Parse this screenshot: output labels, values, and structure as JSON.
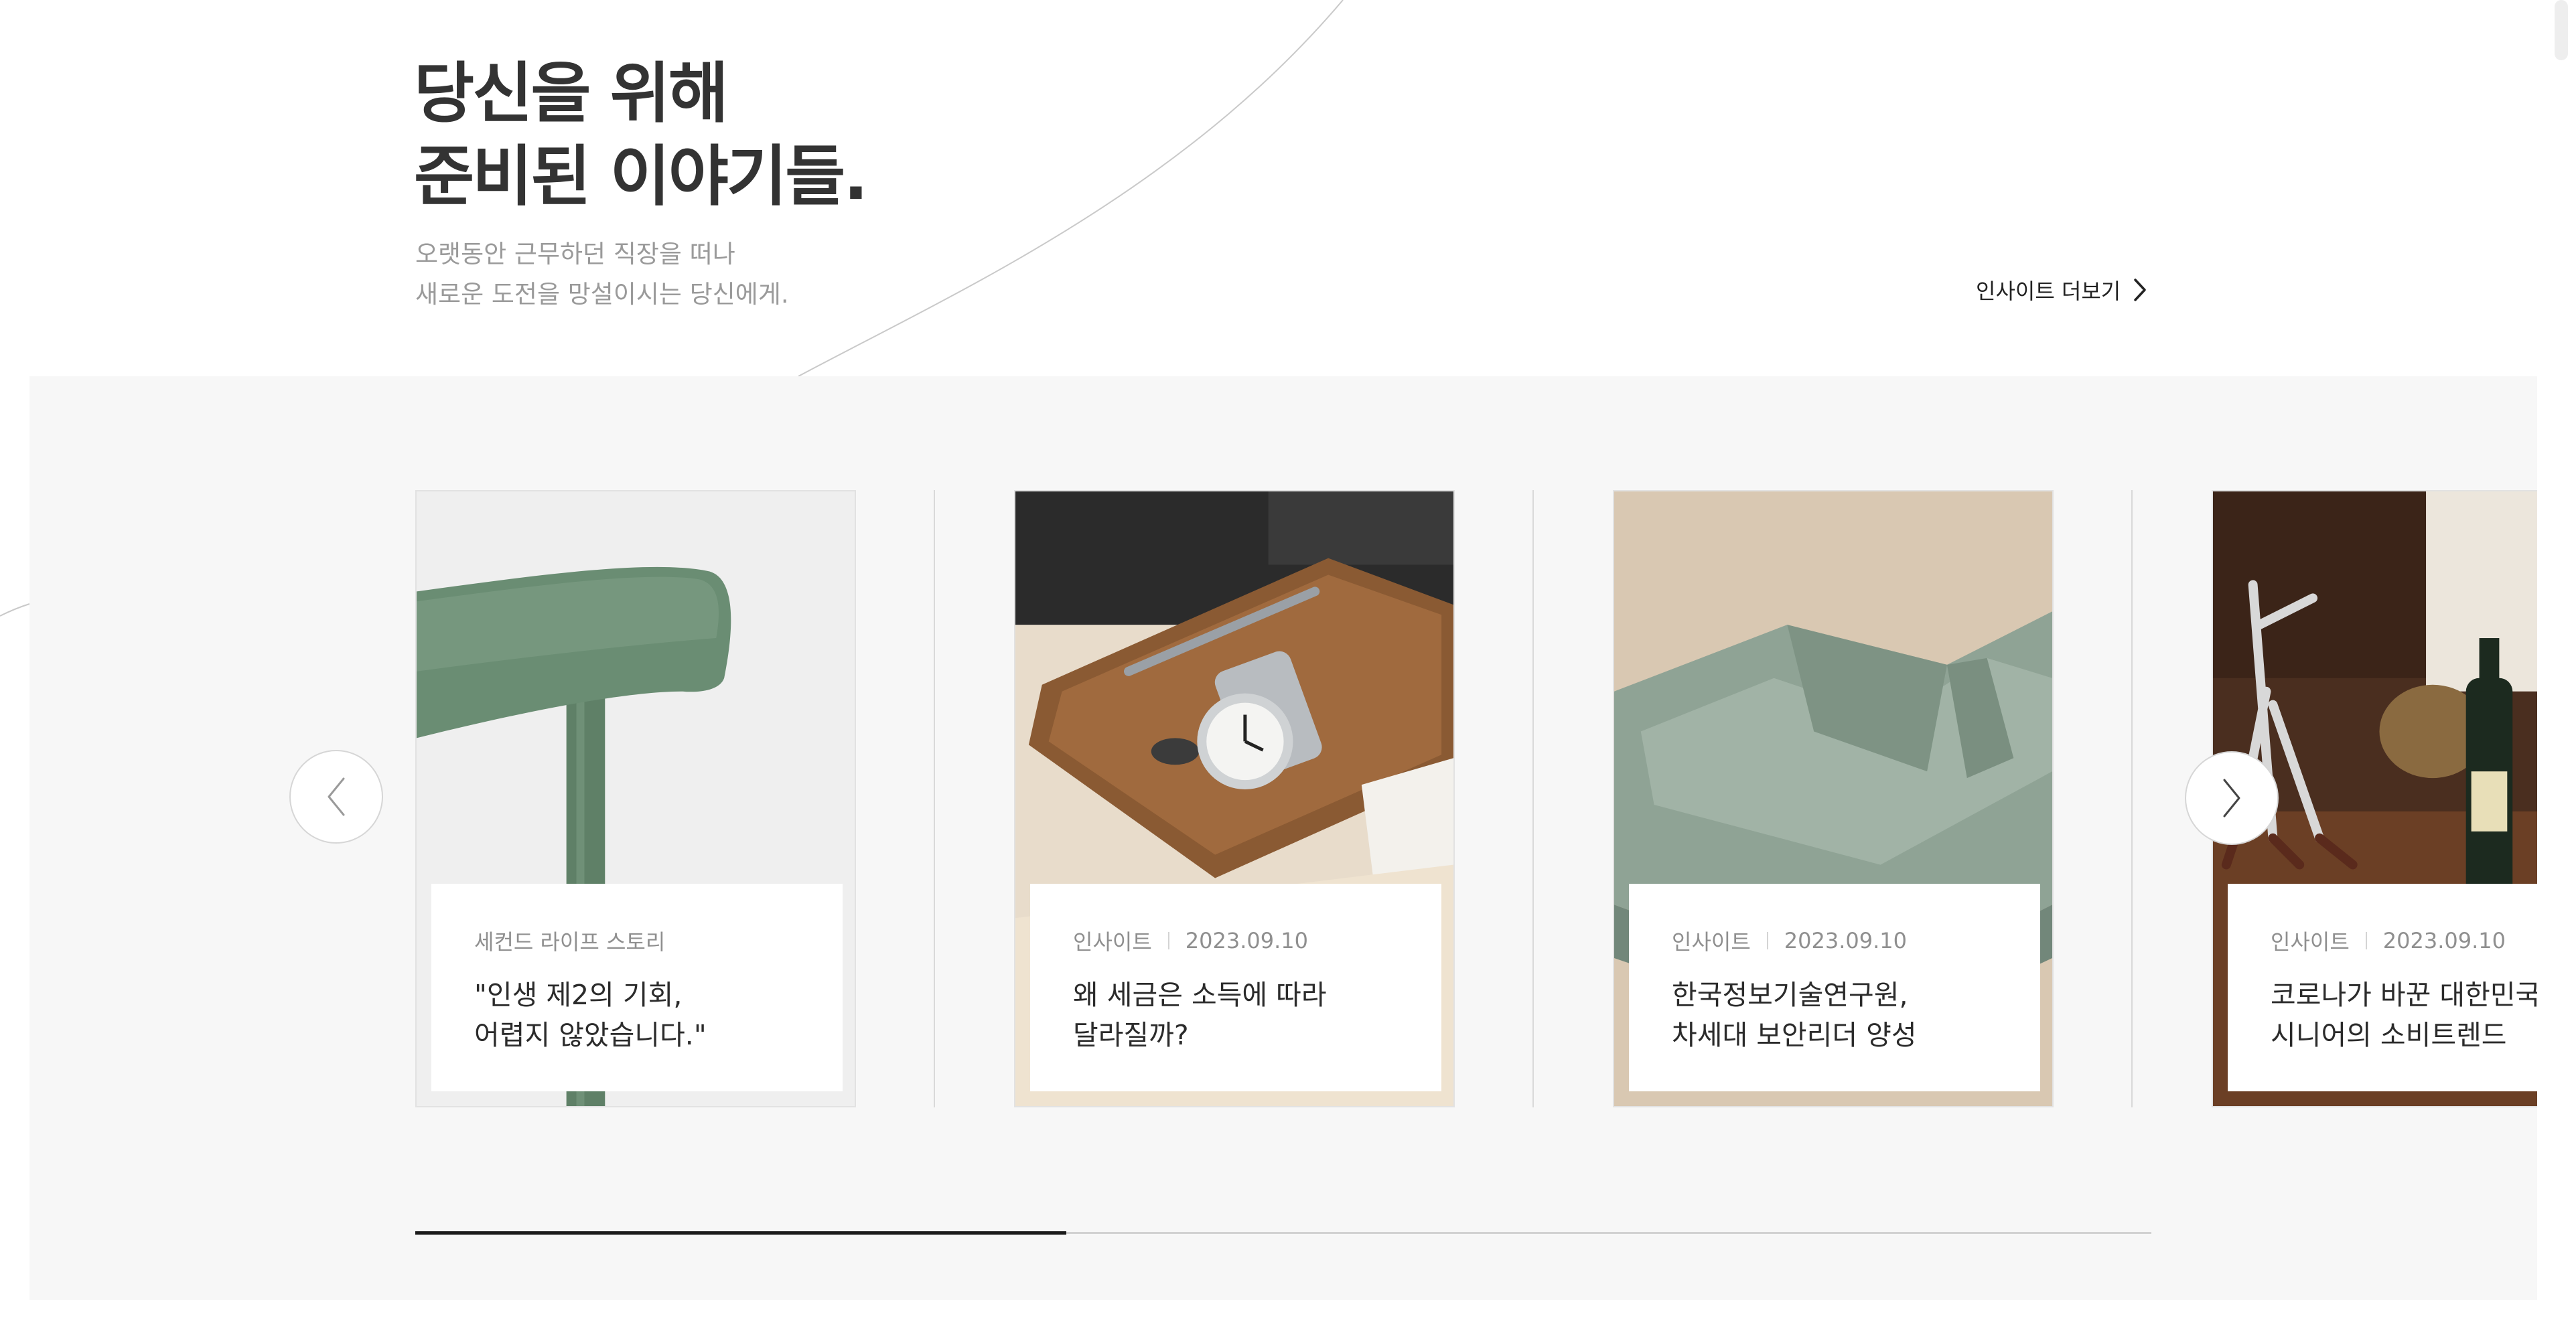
{
  "header": {
    "title_lines": [
      "당신을 위해",
      "준비된 이야기들."
    ],
    "subtitle_lines": [
      "오랫동안 근무하던 직장을 떠나",
      "새로운 도전을 망설이시는 당신에게."
    ],
    "more_label": "인사이트 더보기"
  },
  "cards": [
    {
      "image": "green-chair-photo",
      "category": "세컨드 라이프 스토리",
      "date": "",
      "title_lines": [
        "\"인생 제2의 기회,",
        "어렵지 않았습니다.\""
      ]
    },
    {
      "image": "wooden-tray-watch-photo",
      "category": "인사이트",
      "date": "2023.09.10",
      "title_lines": [
        "왜 세금은 소득에 따라",
        "달라질까?"
      ]
    },
    {
      "image": "green-sofa-photo",
      "category": "인사이트",
      "date": "2023.09.10",
      "title_lines": [
        "한국정보기술연구원,",
        "차세대 보안리더 양성"
      ]
    },
    {
      "image": "wine-bottle-table-photo",
      "category": "인사이트",
      "date": "2023.09.10",
      "title_lines": [
        "코로나가 바꾼 대한민국",
        "시니어의 소비트렌드"
      ]
    }
  ],
  "carousel": {
    "prev_icon": "chevron-left-icon",
    "next_icon": "chevron-right-icon",
    "progress": 0.375
  },
  "colors": {
    "band_bg": "#f7f7f7",
    "heading": "#333333",
    "muted": "#9a9a9a",
    "progress_fill": "#1a1a1a",
    "progress_track": "#d2d2d2"
  }
}
